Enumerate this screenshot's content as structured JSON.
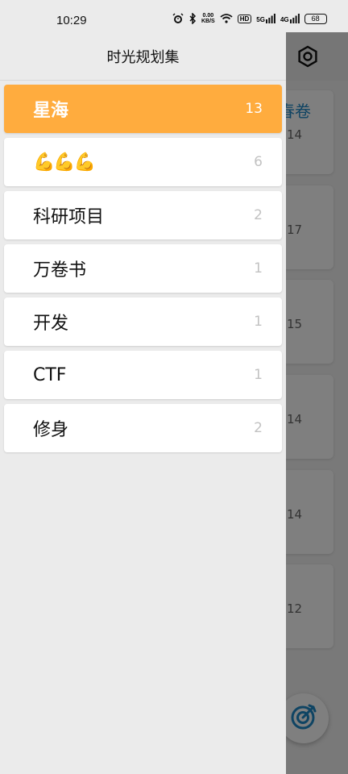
{
  "status_bar": {
    "time": "10:29",
    "net_speed": "0.00",
    "net_unit": "KB/S",
    "hd": "HD",
    "signal1": "5G",
    "signal2": "4G",
    "battery": "68"
  },
  "background": {
    "cards": [
      {
        "title": "春卷",
        "count": "14"
      },
      {
        "title": "",
        "count": "17"
      },
      {
        "title": "",
        "count": "15"
      },
      {
        "title": "",
        "count": "14"
      },
      {
        "title": "",
        "count": "14"
      },
      {
        "title": "",
        "count": "12"
      }
    ]
  },
  "drawer": {
    "title": "时光规划集",
    "items": [
      {
        "label": "星海",
        "count": "13"
      },
      {
        "label": "💪💪💪",
        "count": "6"
      },
      {
        "label": "科研项目",
        "count": "2"
      },
      {
        "label": "万卷书",
        "count": "1"
      },
      {
        "label": "开发",
        "count": "1"
      },
      {
        "label": "CTF",
        "count": "1"
      },
      {
        "label": "修身",
        "count": "2"
      }
    ]
  },
  "colors": {
    "accent": "#ffac3e",
    "link": "#1e88c7"
  }
}
